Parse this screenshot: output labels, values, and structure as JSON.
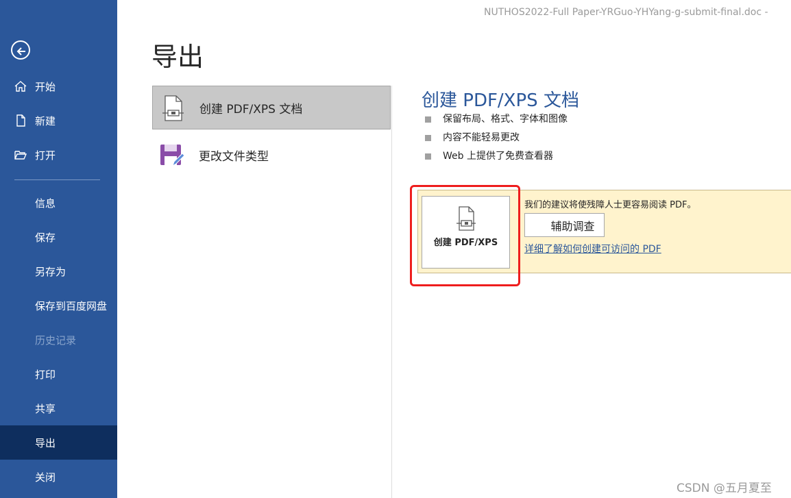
{
  "window": {
    "document_title": "NUTHOS2022-Full Paper-YRGuo-YHYang-g-submit-final.doc  -"
  },
  "sidebar": {
    "back_icon": "back-arrow-icon",
    "items": [
      {
        "label": "开始",
        "icon": "home-icon"
      },
      {
        "label": "新建",
        "icon": "new-document-icon"
      },
      {
        "label": "打开",
        "icon": "open-folder-icon"
      },
      {
        "label": "信息"
      },
      {
        "label": "保存"
      },
      {
        "label": "另存为"
      },
      {
        "label": "保存到百度网盘"
      },
      {
        "label": "历史记录",
        "disabled": true
      },
      {
        "label": "打印"
      },
      {
        "label": "共享"
      },
      {
        "label": "导出",
        "active": true
      },
      {
        "label": "关闭"
      }
    ],
    "colors": {
      "background": "#2b579a",
      "active": "#0e2e5e"
    }
  },
  "main": {
    "title": "导出",
    "options": [
      {
        "label": "创建 PDF/XPS 文档",
        "icon": "pdf-document-icon",
        "selected": true
      },
      {
        "label": "更改文件类型",
        "icon": "save-edit-icon",
        "selected": false
      }
    ]
  },
  "detail": {
    "title": "创建 PDF/XPS 文档",
    "bullets": [
      "保留布局、格式、字体和图像",
      "内容不能轻易更改",
      "Web 上提供了免费查看器"
    ],
    "create_button_label": "创建 PDF/XPS",
    "create_button_icon": "pdf-document-icon",
    "advice_text": "我们的建议将使残障人士更容易阅读 PDF。",
    "accessibility_button_label": "辅助调查",
    "learn_link_text": "详细了解如何创建可访问的 PDF",
    "accent_color": "#2b579a",
    "highlight_color": "#ee1d1d"
  },
  "watermark": "CSDN @五月夏至"
}
